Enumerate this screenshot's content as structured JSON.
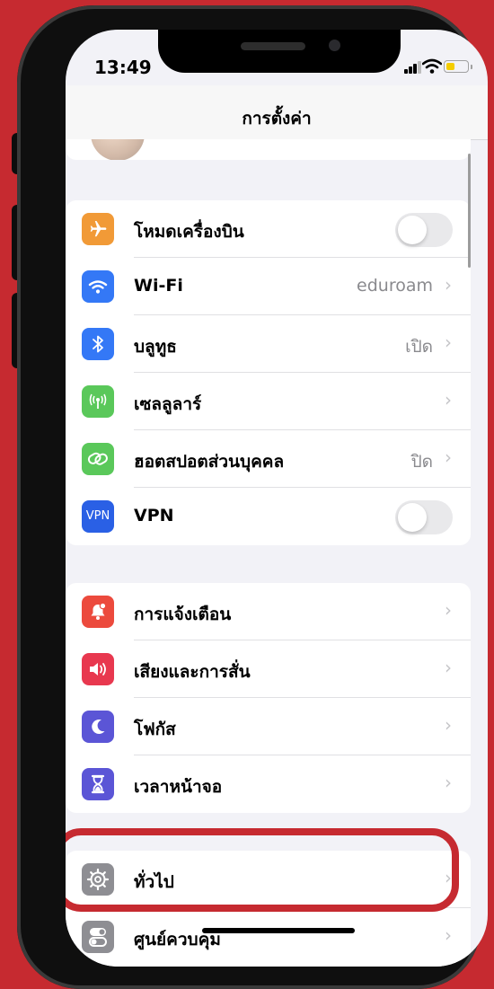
{
  "status": {
    "time": "13:49"
  },
  "nav": {
    "title": "การตั้งค่า"
  },
  "groups": {
    "connectivity": [
      {
        "label": "โหมดเครื่องบิน",
        "icon": "airplane-icon",
        "icon_color": "#f19a37",
        "control": "toggle",
        "toggle_on": false
      },
      {
        "label": "Wi-Fi",
        "value": "eduroam",
        "icon": "wifi-icon",
        "icon_color": "#3478f6"
      },
      {
        "label": "บลูทูธ",
        "value": "เปิด",
        "icon": "bluetooth-icon",
        "icon_color": "#3478f6"
      },
      {
        "label": "เซลลูลาร์",
        "value": "",
        "icon": "cellular-icon",
        "icon_color": "#5ac85a"
      },
      {
        "label": "ฮอตสปอตส่วนบุคคล",
        "value": "ปิด",
        "icon": "hotspot-icon",
        "icon_color": "#5ac85a"
      },
      {
        "label": "VPN",
        "icon": "vpn-icon",
        "icon_text": "VPN",
        "icon_color": "#2a60e5",
        "control": "toggle",
        "toggle_on": false
      }
    ],
    "attention": [
      {
        "label": "การแจ้งเตือน",
        "icon": "notifications-icon",
        "icon_color": "#ec4a3d"
      },
      {
        "label": "เสียงและการสั่น",
        "icon": "sound-icon",
        "icon_color": "#e8384f"
      },
      {
        "label": "โฟกัส",
        "icon": "moon-icon",
        "icon_color": "#5b55d6"
      },
      {
        "label": "เวลาหน้าจอ",
        "icon": "hourglass-icon",
        "icon_color": "#5b55d6"
      }
    ],
    "system": [
      {
        "label": "ทั่วไป",
        "icon": "gear-icon",
        "icon_color": "#8e8e93",
        "highlighted": true
      },
      {
        "label": "ศูนย์ควบคุม",
        "icon": "control-center-icon",
        "icon_color": "#8e8e93"
      }
    ]
  }
}
